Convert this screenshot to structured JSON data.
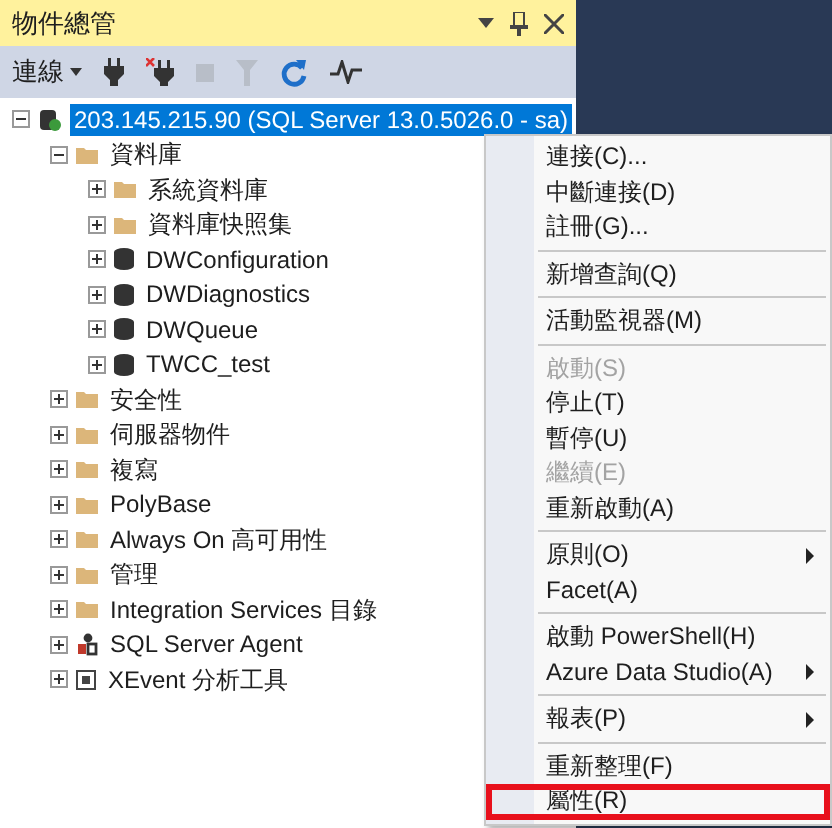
{
  "panel": {
    "title": "物件總管"
  },
  "toolbar": {
    "connect_label": "連線",
    "buttons": [
      {
        "kind": "connect",
        "disabled": false
      },
      {
        "kind": "disconnect",
        "disabled": false
      },
      {
        "kind": "stop",
        "disabled": true
      },
      {
        "kind": "filter",
        "disabled": true
      },
      {
        "kind": "refresh",
        "disabled": false
      },
      {
        "kind": "activity",
        "disabled": false
      }
    ]
  },
  "tree": [
    {
      "label": "203.145.215.90 (SQL Server 13.0.5026.0 - sa)",
      "kind": "server",
      "expanded": true,
      "selected": true,
      "children": [
        {
          "label": "資料庫",
          "kind": "folder",
          "expanded": true,
          "selected": false,
          "children": [
            {
              "label": "系統資料庫",
              "kind": "folder",
              "expanded": false,
              "selected": false
            },
            {
              "label": "資料庫快照集",
              "kind": "folder",
              "expanded": false,
              "selected": false
            },
            {
              "label": "DWConfiguration",
              "kind": "database",
              "expanded": false,
              "selected": false
            },
            {
              "label": "DWDiagnostics",
              "kind": "database",
              "expanded": false,
              "selected": false
            },
            {
              "label": "DWQueue",
              "kind": "database",
              "expanded": false,
              "selected": false
            },
            {
              "label": "TWCC_test",
              "kind": "database",
              "expanded": false,
              "selected": false
            }
          ]
        },
        {
          "label": "安全性",
          "kind": "folder",
          "expanded": false,
          "selected": false
        },
        {
          "label": "伺服器物件",
          "kind": "folder",
          "expanded": false,
          "selected": false
        },
        {
          "label": "複寫",
          "kind": "folder",
          "expanded": false,
          "selected": false
        },
        {
          "label": "PolyBase",
          "kind": "folder",
          "expanded": false,
          "selected": false
        },
        {
          "label": "Always On 高可用性",
          "kind": "folder",
          "expanded": false,
          "selected": false
        },
        {
          "label": "管理",
          "kind": "folder",
          "expanded": false,
          "selected": false
        },
        {
          "label": "Integration Services 目錄",
          "kind": "folder",
          "expanded": false,
          "selected": false
        },
        {
          "label": "SQL Server Agent",
          "kind": "agent",
          "expanded": false,
          "selected": false
        },
        {
          "label": "XEvent 分析工具",
          "kind": "xevent",
          "expanded": false,
          "selected": false
        }
      ]
    }
  ],
  "context_menu": {
    "groups": [
      [
        {
          "label": "連接(C)...",
          "disabled": false,
          "submenu": false,
          "highlighted": false
        },
        {
          "label": "中斷連接(D)",
          "disabled": false,
          "submenu": false,
          "highlighted": false
        },
        {
          "label": "註冊(G)...",
          "disabled": false,
          "submenu": false,
          "highlighted": false
        }
      ],
      [
        {
          "label": "新增查詢(Q)",
          "disabled": false,
          "submenu": false,
          "highlighted": false
        }
      ],
      [
        {
          "label": "活動監視器(M)",
          "disabled": false,
          "submenu": false,
          "highlighted": false
        }
      ],
      [
        {
          "label": "啟動(S)",
          "disabled": true,
          "submenu": false,
          "highlighted": false
        },
        {
          "label": "停止(T)",
          "disabled": false,
          "submenu": false,
          "highlighted": false
        },
        {
          "label": "暫停(U)",
          "disabled": false,
          "submenu": false,
          "highlighted": false
        },
        {
          "label": "繼續(E)",
          "disabled": true,
          "submenu": false,
          "highlighted": false
        },
        {
          "label": "重新啟動(A)",
          "disabled": false,
          "submenu": false,
          "highlighted": false
        }
      ],
      [
        {
          "label": "原則(O)",
          "disabled": false,
          "submenu": true,
          "highlighted": false
        },
        {
          "label": "Facet(A)",
          "disabled": false,
          "submenu": false,
          "highlighted": false
        }
      ],
      [
        {
          "label": "啟動 PowerShell(H)",
          "disabled": false,
          "submenu": false,
          "highlighted": false
        },
        {
          "label": "Azure Data Studio(A)",
          "disabled": false,
          "submenu": true,
          "highlighted": false
        }
      ],
      [
        {
          "label": "報表(P)",
          "disabled": false,
          "submenu": true,
          "highlighted": false
        }
      ],
      [
        {
          "label": "重新整理(F)",
          "disabled": false,
          "submenu": false,
          "highlighted": false
        },
        {
          "label": "屬性(R)",
          "disabled": false,
          "submenu": false,
          "highlighted": true
        }
      ]
    ]
  }
}
